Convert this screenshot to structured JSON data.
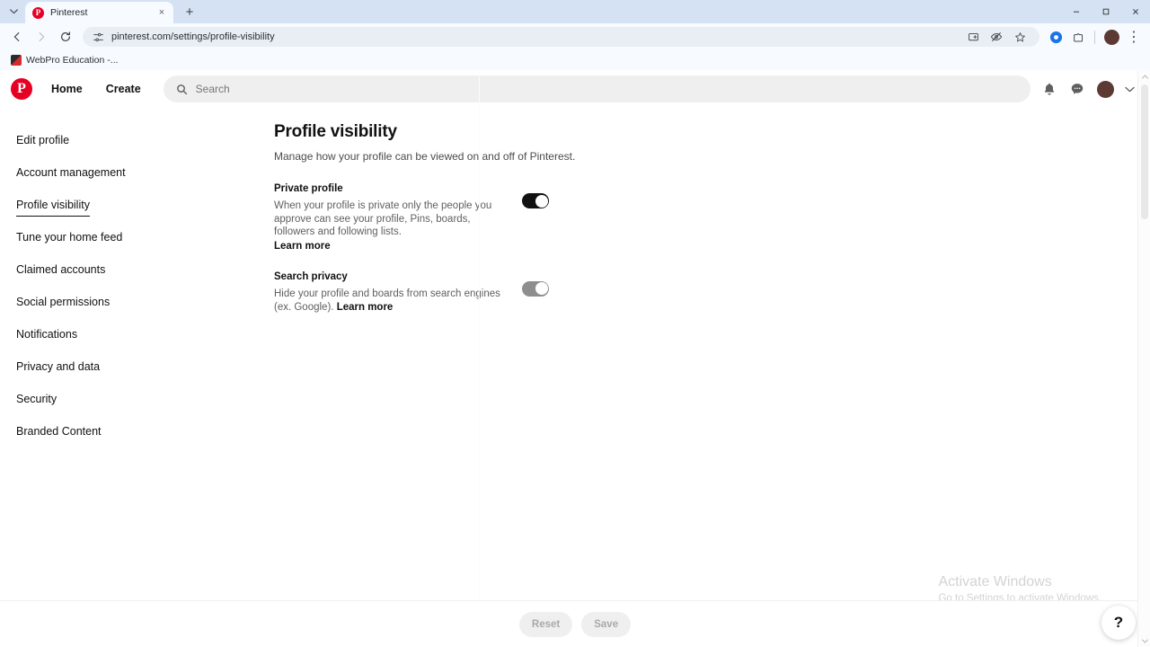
{
  "browser": {
    "tab": {
      "title": "Pinterest",
      "favicon_letter": "P",
      "favicon_name": "pinterest-favicon",
      "close_label": "×"
    },
    "tab_list_button": "⌄",
    "new_tab_button": "+",
    "window_controls": {
      "minimize": "–",
      "maximize": "❐",
      "close": "×"
    },
    "nav": {
      "back": "←",
      "forward": "→",
      "reload": "↻"
    },
    "omnibox": {
      "url": "pinterest.com/settings/profile-visibility",
      "site_settings_icon": "tune-icon"
    },
    "toolbar_icons": [
      {
        "name": "cast-screen-icon",
        "glyph": "⎘"
      },
      {
        "name": "eye-off-icon",
        "glyph": "⌽"
      },
      {
        "name": "bookmark-star-icon",
        "glyph": "☆"
      },
      {
        "name": "sync-circle-icon",
        "glyph": "●"
      },
      {
        "name": "extensions-puzzle-icon",
        "glyph": "⬚"
      }
    ],
    "profile_avatar": "browser-profile-avatar",
    "menu_icon": "⋮",
    "bookmark": {
      "label": "WebPro Education -...",
      "favicon_name": "webpro-education-favicon"
    }
  },
  "pinterest_header": {
    "logo": "pinterest-logo",
    "logo_letter": "P",
    "links": [
      {
        "label": "Home"
      },
      {
        "label": "Create"
      }
    ],
    "search": {
      "placeholder": "Search",
      "value": "",
      "icon": "search-icon"
    },
    "actions": [
      {
        "name": "notifications-bell-icon",
        "glyph": "🔔"
      },
      {
        "name": "messages-bubble-icon",
        "glyph": "💬"
      }
    ],
    "avatar": "user-avatar",
    "chevron": "⌄"
  },
  "sidebar": {
    "items": [
      {
        "label": "Edit profile",
        "active": false
      },
      {
        "label": "Account management",
        "active": false
      },
      {
        "label": "Profile visibility",
        "active": true
      },
      {
        "label": "Tune your home feed",
        "active": false
      },
      {
        "label": "Claimed accounts",
        "active": false
      },
      {
        "label": "Social permissions",
        "active": false
      },
      {
        "label": "Notifications",
        "active": false
      },
      {
        "label": "Privacy and data",
        "active": false
      },
      {
        "label": "Security",
        "active": false
      },
      {
        "label": "Branded Content",
        "active": false
      }
    ]
  },
  "main": {
    "title": "Profile visibility",
    "subtitle": "Manage how your profile can be viewed on and off of Pinterest.",
    "settings": [
      {
        "label": "Private profile",
        "description": "When your profile is private only the people you approve can see your profile, Pins, boards, followers and following lists.",
        "learn_more": "Learn more",
        "learn_more_block": true,
        "toggle_state": "on"
      },
      {
        "label": "Search privacy",
        "description": "Hide your profile and boards from search engines (ex. Google).",
        "learn_more": "Learn more",
        "learn_more_block": false,
        "toggle_state": "muted"
      }
    ]
  },
  "action_bar": {
    "reset_label": "Reset",
    "save_label": "Save",
    "disabled": true
  },
  "help_button": {
    "glyph": "?",
    "name": "help-button"
  },
  "watermark": {
    "title": "Activate Windows",
    "subtitle": "Go to Settings to activate Windows."
  },
  "colors": {
    "pinterest_red": "#e60023",
    "tabstrip": "#d4e2f3",
    "chrome_surface": "#f7fbff",
    "omnibox": "#e9eef4",
    "toggle_on": "#111111",
    "toggle_muted": "#8e8e8e",
    "disabled_pill": "#efefef"
  }
}
